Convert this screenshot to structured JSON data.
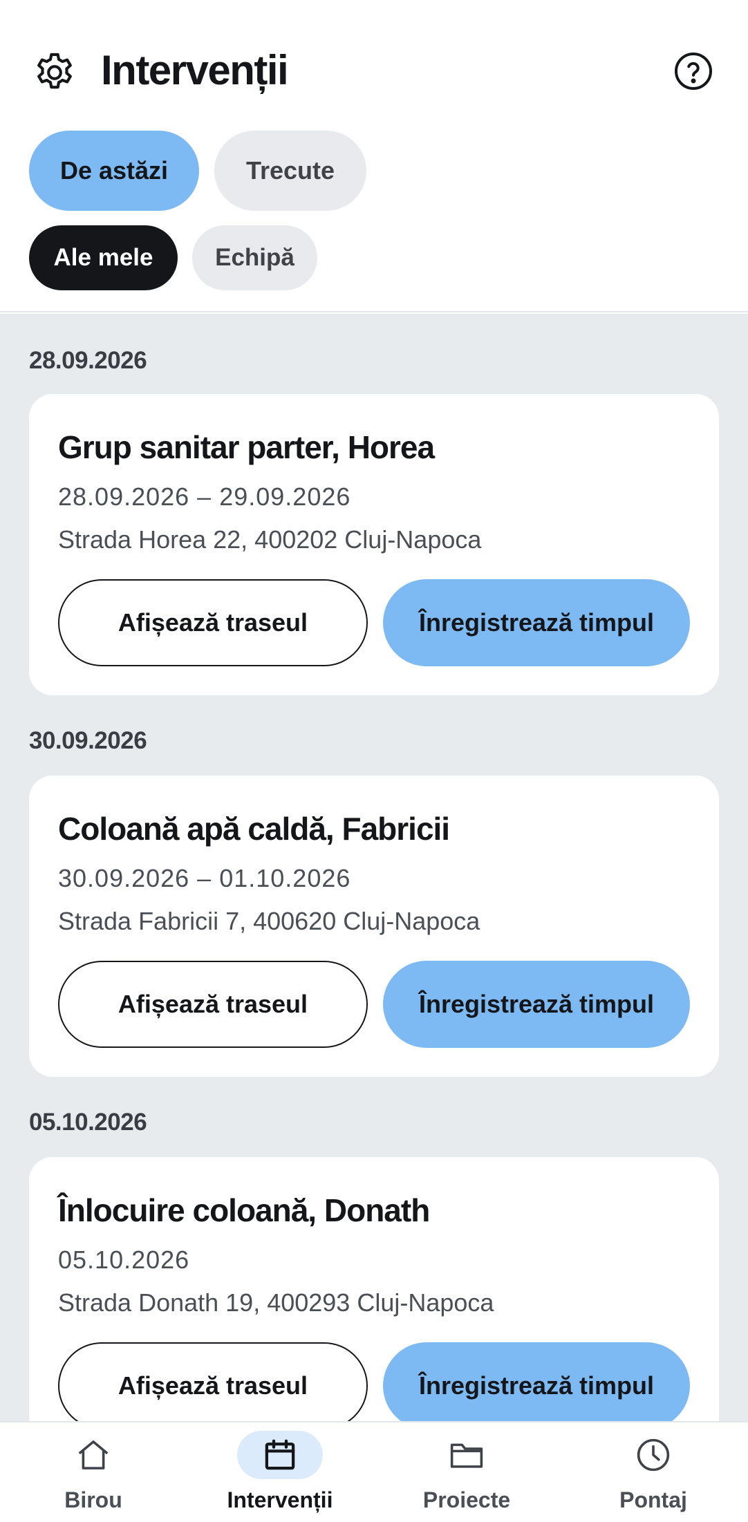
{
  "header": {
    "title": "Intervenții",
    "settings_icon": "gear-icon",
    "help_icon": "help-circle-icon"
  },
  "filters": {
    "period": [
      {
        "label": "De astăzi",
        "selected": true
      },
      {
        "label": "Trecute",
        "selected": false
      }
    ],
    "scope": [
      {
        "label": "Ale mele",
        "selected": true
      },
      {
        "label": "Echipă",
        "selected": false
      }
    ]
  },
  "sections": [
    {
      "date": "28.09.2026",
      "card": {
        "title": "Grup sanitar parter, Horea",
        "dates": "28.09.2026 – 29.09.2026",
        "address": "Strada Horea 22, 400202 Cluj-Napoca",
        "route_label": "Afișează traseul",
        "time_label": "Înregistrează timpul"
      }
    },
    {
      "date": "30.09.2026",
      "card": {
        "title": "Coloană apă caldă, Fabricii",
        "dates": "30.09.2026 – 01.10.2026",
        "address": "Strada Fabricii 7, 400620 Cluj-Napoca",
        "route_label": "Afișează traseul",
        "time_label": "Înregistrează timpul"
      }
    },
    {
      "date": "05.10.2026",
      "card": {
        "title": "Înlocuire coloană, Donath",
        "dates": "05.10.2026",
        "address": "Strada Donath 19, 400293 Cluj-Napoca",
        "route_label": "Afișează traseul",
        "time_label": "Înregistrează timpul"
      }
    }
  ],
  "nav": [
    {
      "label": "Birou",
      "icon": "home-icon",
      "active": false
    },
    {
      "label": "Intervenții",
      "icon": "calendar-icon",
      "active": true
    },
    {
      "label": "Proiecte",
      "icon": "folder-icon",
      "active": false
    },
    {
      "label": "Pontaj",
      "icon": "clock-icon",
      "active": false
    }
  ],
  "colors": {
    "accent": "#7db9f3",
    "chip_dark": "#14161a",
    "chip_light": "#e8eaed",
    "list_background": "#e8ebee",
    "nav_active_pill": "#dcebfb"
  }
}
